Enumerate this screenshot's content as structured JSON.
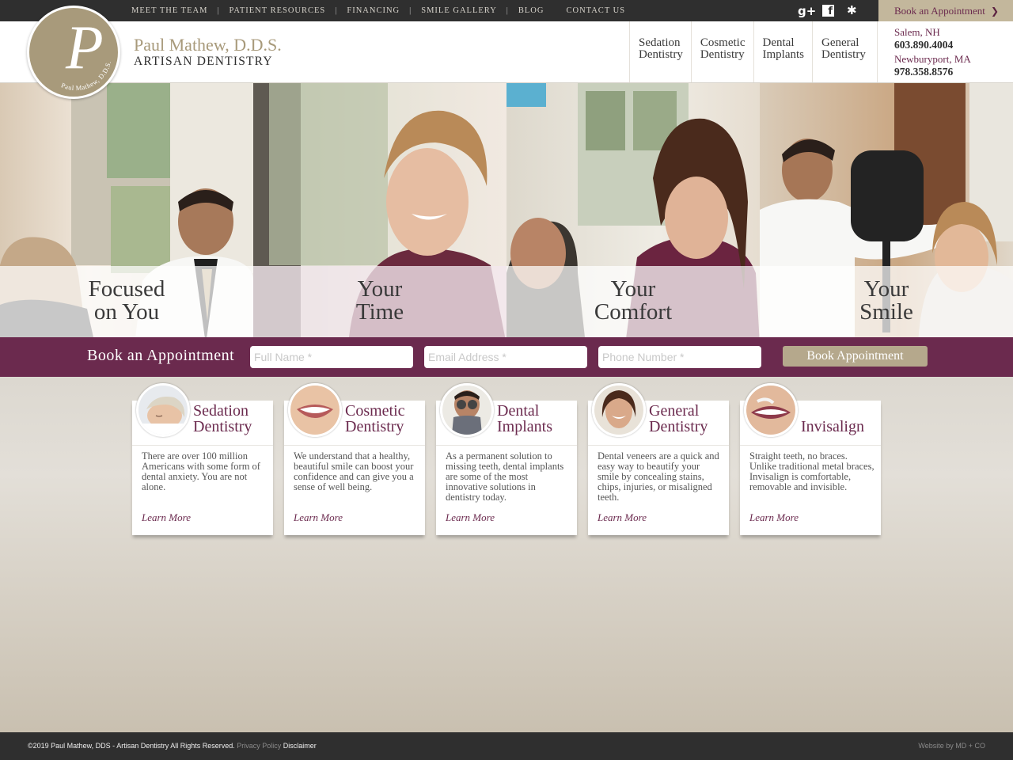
{
  "top_nav": {
    "items": [
      "MEET THE TEAM",
      "PATIENT RESOURCES",
      "FINANCING",
      "SMILE GALLERY",
      "BLOG",
      "CONTACT US"
    ],
    "separator": "|"
  },
  "social": {
    "googleplus": "g+",
    "facebook": "f",
    "yelp": "✱"
  },
  "book_top": {
    "label": "Book an Appointment",
    "chevron": "❯"
  },
  "brand": {
    "name": "Paul Mathew, D.D.S.",
    "subtitle": "ARTISAN DENTISTRY",
    "logo_letter": "P",
    "logo_ring_text": "Paul Mathew, D.D.S."
  },
  "main_nav": [
    {
      "line1": "Sedation",
      "line2": "Dentistry"
    },
    {
      "line1": "Cosmetic",
      "line2": "Dentistry"
    },
    {
      "line1": "Dental",
      "line2": "Implants"
    },
    {
      "line1": "General",
      "line2": "Dentistry"
    }
  ],
  "locations": [
    {
      "city": "Salem, NH",
      "phone": "603.890.4004"
    },
    {
      "city": "Newburyport, MA",
      "phone": "978.358.8576"
    }
  ],
  "hero": [
    {
      "line1": "Focused",
      "line2": "on You"
    },
    {
      "line1": "Your",
      "line2": "Time"
    },
    {
      "line1": "Your",
      "line2": "Comfort"
    },
    {
      "line1": "Your",
      "line2": "Smile"
    }
  ],
  "booking": {
    "label": "Book an Appointment",
    "name_placeholder": "Full Name *",
    "email_placeholder": "Email Address *",
    "phone_placeholder": "Phone Number *",
    "button": "Book Appointment"
  },
  "services": [
    {
      "line1": "Sedation",
      "line2": "Dentistry",
      "desc": "There are over 100 million Americans with some form of dental anxiety. You are not alone.",
      "more": "Learn More"
    },
    {
      "line1": "Cosmetic",
      "line2": "Dentistry",
      "desc": "We understand that a healthy, beautiful smile can boost your confidence and can give you a sense of well being.",
      "more": "Learn More"
    },
    {
      "line1": "Dental",
      "line2": "Implants",
      "desc": "As a permanent solution to missing teeth, dental implants are some of the most innovative solutions in dentistry today.",
      "more": "Learn More"
    },
    {
      "line1": "General",
      "line2": "Dentistry",
      "desc": "Dental veneers are a quick and easy way to beautify your smile by concealing stains, chips, injuries, or misaligned teeth.",
      "more": "Learn More"
    },
    {
      "line1": "Invisalign",
      "desc": "Straight teeth, no braces. Unlike traditional metal braces, Invisalign is comfortable, removable and invisible.",
      "more": "Learn More"
    }
  ],
  "footer": {
    "copyright": "©2019 Paul Mathew, DDS - Artisan Dentistry All Rights Reserved.",
    "privacy": "Privacy Policy",
    "disclaimer": "Disclaimer",
    "credit": "Website by MD + CO"
  },
  "colors": {
    "plum": "#6b2a4e",
    "taupe": "#a89a7b",
    "dark": "#2f2f2f",
    "gold_button": "#b5a88c"
  }
}
